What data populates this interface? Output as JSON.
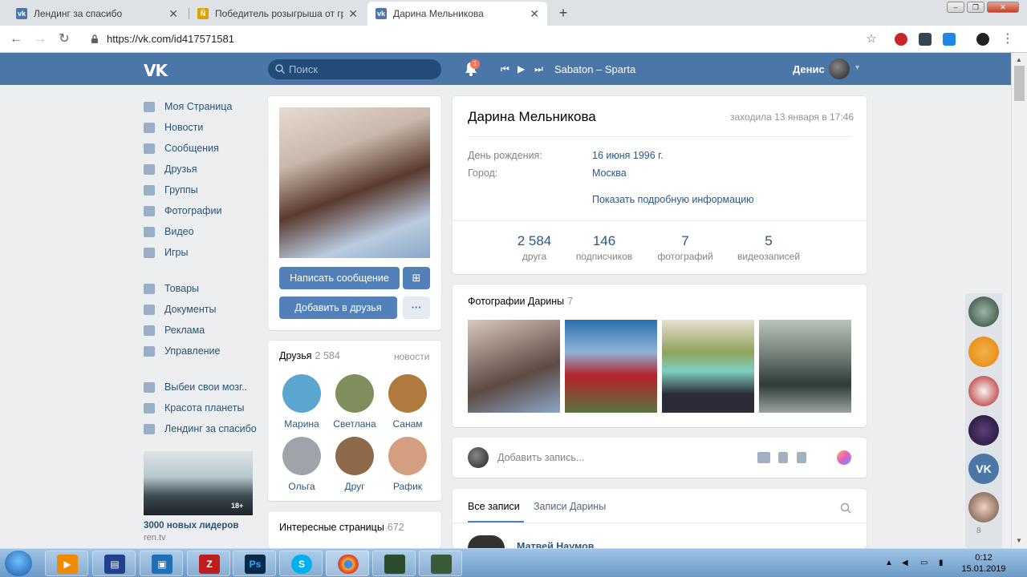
{
  "browser": {
    "tabs": [
      {
        "title": "Лендинг за спасибо",
        "fav_color": "#4a76a8",
        "fav_text": "vk"
      },
      {
        "title": "Победитель розыгрыша от гру",
        "fav_color": "#d9a400",
        "fav_text": "Ñ"
      },
      {
        "title": "Дарина Мельникова",
        "fav_color": "#4a76a8",
        "fav_text": "vk"
      }
    ],
    "close_glyph": "✕",
    "new_tab_glyph": "+",
    "url": "https://vk.com/id417571581",
    "window_controls": [
      "‒",
      "❐",
      "✕"
    ]
  },
  "vk": {
    "search_placeholder": "Поиск",
    "notif_count": "1",
    "track": "Sabaton – Sparta",
    "user_name": "Денис",
    "menu": [
      "Моя Страница",
      "Новости",
      "Сообщения",
      "Друзья",
      "Группы",
      "Фотографии",
      "Видео",
      "Игры",
      "Товары",
      "Документы",
      "Реклама",
      "Управление",
      "Выбеи свои мозг..",
      "Красота планеты",
      "Лендинг за спасибо"
    ],
    "ad": {
      "title": "3000 новых лидеров",
      "source": "ren.tv",
      "badge": "18+"
    },
    "profile": {
      "name": "Дарина Мельникова",
      "last_seen": "заходила 13 января в 17:46",
      "birthday_label": "День рождения:",
      "birthday_value": "16 июня 1996 г.",
      "city_label": "Город:",
      "city_value": "Москва",
      "more_info": "Показать подробную информацию",
      "stats": [
        {
          "num": "2 584",
          "label": "друга"
        },
        {
          "num": "146",
          "label": "подписчиков"
        },
        {
          "num": "7",
          "label": "фотографий"
        },
        {
          "num": "5",
          "label": "видеозаписей"
        }
      ]
    },
    "buttons": {
      "message": "Написать сообщение",
      "add_friend": "Добавить в друзья",
      "more": "···",
      "gift": "⊞"
    },
    "friends": {
      "title": "Друзья",
      "count": "2 584",
      "news": "новости",
      "list": [
        {
          "name": "Марина",
          "color": "#5aa6cf"
        },
        {
          "name": "Светлана",
          "color": "#7f8e5a"
        },
        {
          "name": "Санам",
          "color": "#b07a3e"
        },
        {
          "name": "Ольга",
          "color": "#a0a4aa"
        },
        {
          "name": "Друг",
          "color": "#8e6a4a"
        },
        {
          "name": "Рафик",
          "color": "#d39f80"
        }
      ]
    },
    "interesting": {
      "title": "Интересные страницы",
      "count": "672"
    },
    "photos": {
      "title": "Фотографии Дарины",
      "count": "7",
      "items": [
        {
          "name": "photo-1",
          "color": "#5d4a44"
        },
        {
          "name": "photo-2",
          "color": "#b3232b"
        },
        {
          "name": "photo-3",
          "color": "#8fa35a"
        },
        {
          "name": "photo-4",
          "color": "#6f7a73"
        }
      ]
    },
    "post": {
      "placeholder": "Добавить запись..."
    },
    "wall_tabs": [
      "Все записи",
      "Записи Дарины"
    ],
    "wall_author": "Матвей Наумов",
    "dock_count": "8"
  },
  "taskbar": {
    "time": "0:12",
    "date": "15.01.2019"
  },
  "colors": {
    "vk_blue": "#4a76a8",
    "link": "#2a5885",
    "button": "#5181b8"
  }
}
